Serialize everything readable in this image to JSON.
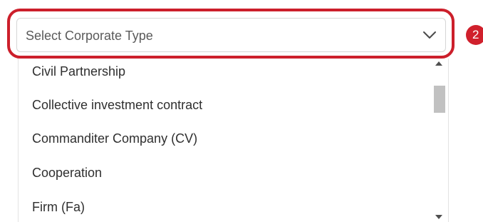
{
  "select": {
    "placeholder": "Select Corporate Type",
    "chevron_icon": "chevron-down-icon"
  },
  "annotation": {
    "step_number": "2",
    "highlight_color": "#cc1f2b"
  },
  "dropdown": {
    "options": [
      "Civil Partnership",
      "Collective investment contract",
      "Commanditer Company (CV)",
      "Cooperation",
      "Firm (Fa)"
    ]
  },
  "scrollbar": {
    "up_icon": "triangle-up-icon",
    "down_icon": "triangle-down-icon"
  }
}
